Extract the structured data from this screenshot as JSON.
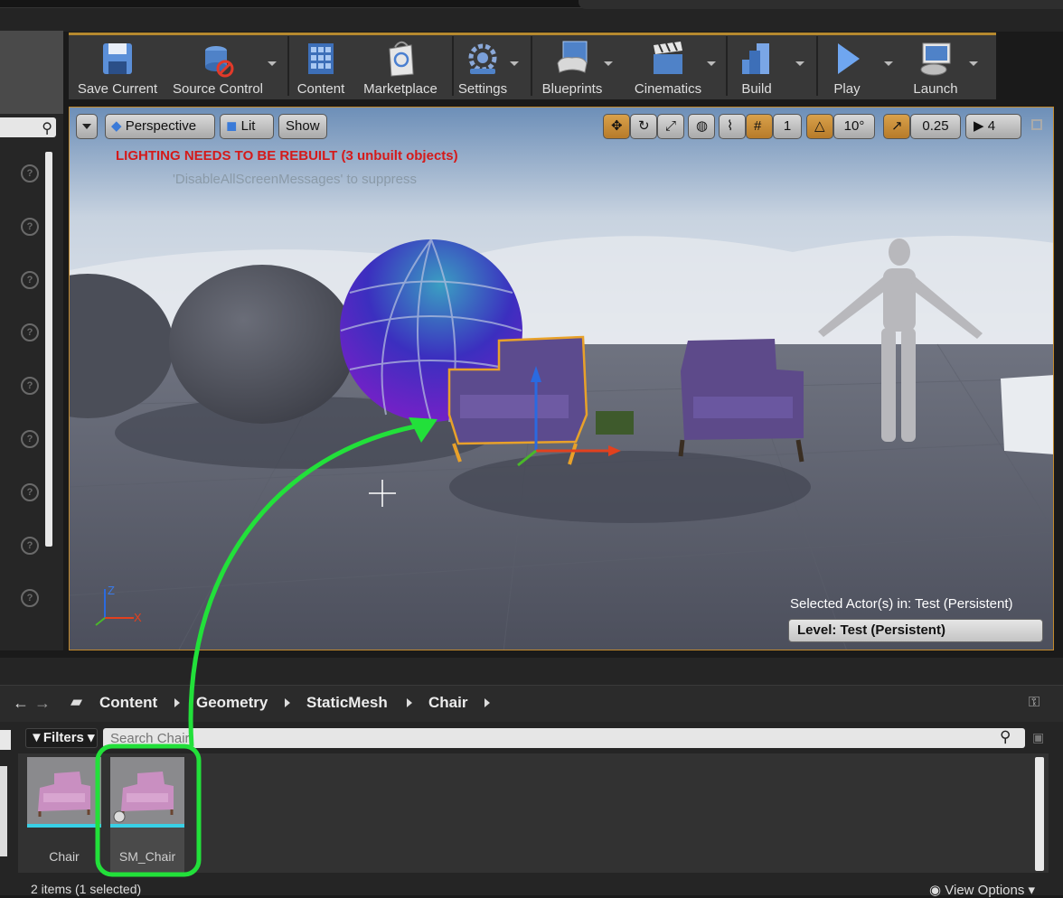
{
  "toolbar": {
    "buttons": [
      {
        "label": "Save Current",
        "icon": "save-icon"
      },
      {
        "label": "Source Control",
        "icon": "source-control-icon"
      },
      {
        "label": "Content",
        "icon": "content-icon"
      },
      {
        "label": "Marketplace",
        "icon": "marketplace-icon"
      },
      {
        "label": "Settings",
        "icon": "settings-icon"
      },
      {
        "label": "Blueprints",
        "icon": "blueprints-icon"
      },
      {
        "label": "Cinematics",
        "icon": "cinematics-icon"
      },
      {
        "label": "Build",
        "icon": "build-icon"
      },
      {
        "label": "Play",
        "icon": "play-icon"
      },
      {
        "label": "Launch",
        "icon": "launch-icon"
      }
    ]
  },
  "viewport": {
    "view_mode": "Perspective",
    "lit_mode": "Lit",
    "show_label": "Show",
    "grid_snap": "1",
    "rotation_snap": "10°",
    "scale_snap": "0.25",
    "camera_speed": "4",
    "lighting_warning": "LIGHTING NEEDS TO BE REBUILT (3 unbuilt objects)",
    "suppress_hint": "'DisableAllScreenMessages' to suppress",
    "selected_actors": "Selected Actor(s) in:  Test (Persistent)",
    "level": "Level:  Test (Persistent)",
    "axis_x": "X",
    "axis_z": "Z"
  },
  "content_browser": {
    "breadcrumbs": [
      "Content",
      "Geometry",
      "StaticMesh",
      "Chair"
    ],
    "filters_label": "Filters",
    "search_placeholder": "Search Chair",
    "assets": [
      {
        "name": "Chair",
        "selected": false
      },
      {
        "name": "SM_Chair",
        "selected": true
      }
    ],
    "status": "2 items (1 selected)",
    "view_options": "View Options"
  },
  "colors": {
    "accent_orange": "#c38a2d",
    "warning_red": "#d41a1a",
    "annotation_green": "#22e03a",
    "thumb_underline": "#39d0e6"
  }
}
